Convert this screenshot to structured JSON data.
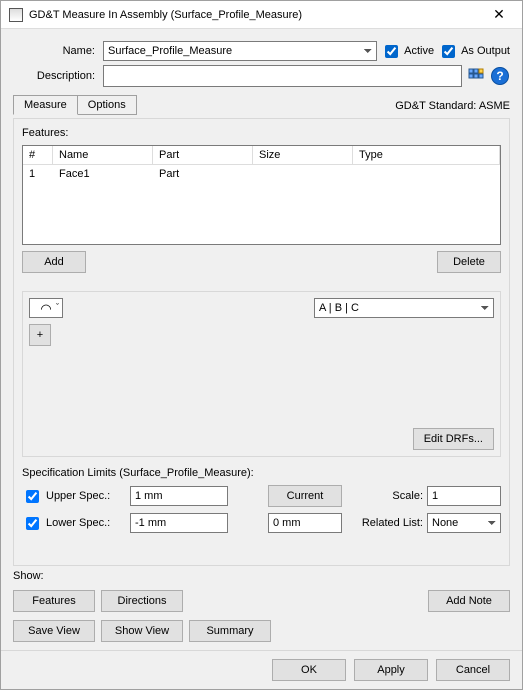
{
  "title": "GD&T Measure In Assembly (Surface_Profile_Measure)",
  "fields": {
    "name_label": "Name:",
    "name_value": "Surface_Profile_Measure",
    "active_label": "Active",
    "as_output_label": "As Output",
    "description_label": "Description:",
    "description_value": ""
  },
  "tabs": {
    "measure": "Measure",
    "options": "Options"
  },
  "gdtstandard": "GD&T Standard: ASME",
  "features": {
    "label": "Features:",
    "columns": {
      "num": "#",
      "name": "Name",
      "part": "Part",
      "size": "Size",
      "type": "Type"
    },
    "rows": [
      {
        "num": "1",
        "name": "Face1",
        "part": "Part",
        "size": "",
        "type": ""
      }
    ],
    "add_btn": "Add",
    "delete_btn": "Delete"
  },
  "datum_select": "A | B | C",
  "plus_btn": "+",
  "edit_drfs_btn": "Edit DRFs...",
  "limits": {
    "heading": "Specification Limits (Surface_Profile_Measure):",
    "upper_label": "Upper Spec.:",
    "upper_value": "1 mm",
    "lower_label": "Lower Spec.:",
    "lower_value": "-1 mm",
    "current_btn": "Current",
    "current_value": "0 mm",
    "scale_label": "Scale:",
    "scale_value": "1",
    "related_label": "Related List:",
    "related_value": "None"
  },
  "show": {
    "label": "Show:",
    "features": "Features",
    "directions": "Directions",
    "add_note": "Add Note",
    "save_view": "Save View",
    "show_view": "Show View",
    "summary": "Summary"
  },
  "footer": {
    "ok": "OK",
    "apply": "Apply",
    "cancel": "Cancel"
  }
}
